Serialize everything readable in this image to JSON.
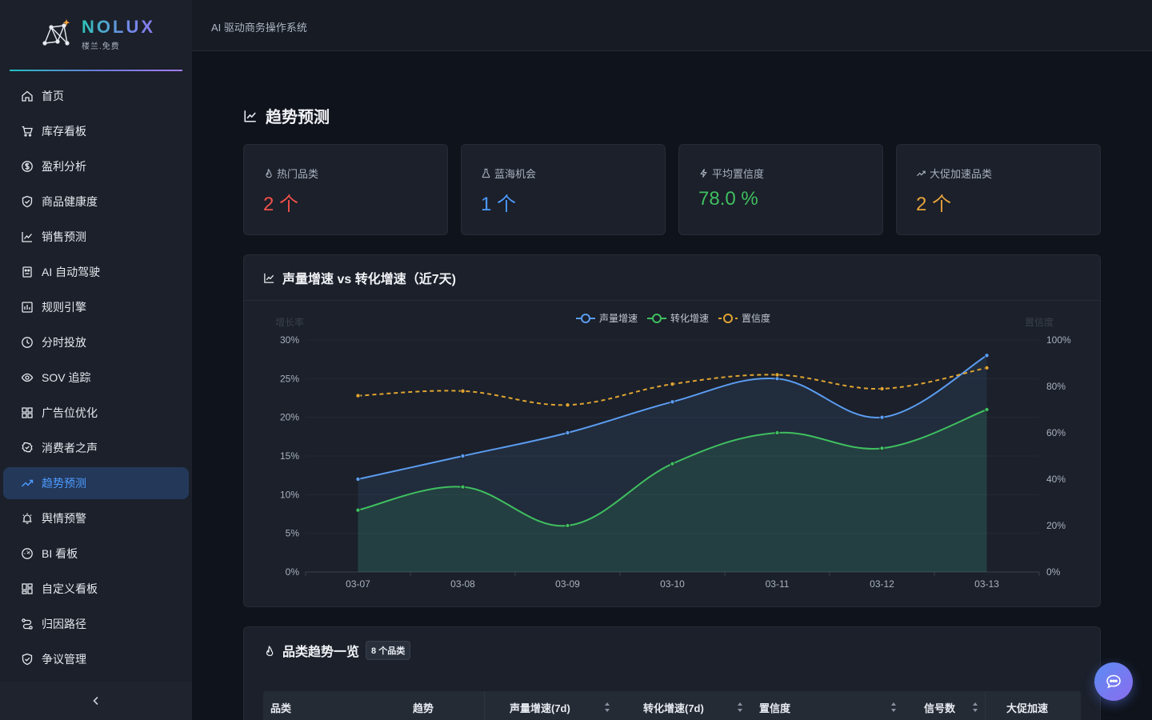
{
  "brand": {
    "name": "NOLUX",
    "subtitle": "楼兰.免费"
  },
  "topbar": {
    "title": "AI 驱动商务操作系统"
  },
  "sidebar": {
    "items": [
      {
        "label": "首页",
        "icon": "home-icon"
      },
      {
        "label": "库存看板",
        "icon": "cart-icon"
      },
      {
        "label": "盈利分析",
        "icon": "coin-icon"
      },
      {
        "label": "商品健康度",
        "icon": "shield-check-icon"
      },
      {
        "label": "销售预测",
        "icon": "line-chart-icon"
      },
      {
        "label": "AI 自动驾驶",
        "icon": "robot-icon"
      },
      {
        "label": "规则引擎",
        "icon": "rules-icon"
      },
      {
        "label": "分时投放",
        "icon": "clock-icon"
      },
      {
        "label": "SOV 追踪",
        "icon": "eye-icon"
      },
      {
        "label": "广告位优化",
        "icon": "grid-icon"
      },
      {
        "label": "消费者之声",
        "icon": "badge-icon"
      },
      {
        "label": "趋势预测",
        "icon": "trend-icon",
        "active": true
      },
      {
        "label": "舆情预警",
        "icon": "alarm-icon"
      },
      {
        "label": "BI 看板",
        "icon": "dashboard-icon"
      },
      {
        "label": "自定义看板",
        "icon": "layout-icon"
      },
      {
        "label": "归因路径",
        "icon": "route-icon"
      },
      {
        "label": "争议管理",
        "icon": "shield-check-icon"
      }
    ],
    "collapse_label": "‹"
  },
  "page": {
    "title": "趋势预测"
  },
  "stats": [
    {
      "label": "热门品类",
      "value": "2 个",
      "color": "#f0504a",
      "icon": "fire-icon"
    },
    {
      "label": "蓝海机会",
      "value": "1 个",
      "color": "#4d9bff",
      "icon": "flask-icon"
    },
    {
      "label": "平均置信度",
      "value": "78.0 %",
      "color": "#3fbf5f",
      "icon": "lightning-icon"
    },
    {
      "label": "大促加速品类",
      "value": "2 个",
      "color": "#e8a33c",
      "icon": "rise-icon"
    }
  ],
  "chart_card": {
    "title": "声量增速 vs 转化增速（近7天)"
  },
  "chart_data": {
    "type": "line",
    "categories": [
      "03-07",
      "03-08",
      "03-09",
      "03-10",
      "03-11",
      "03-12",
      "03-13"
    ],
    "series": [
      {
        "name": "声量增速",
        "values": [
          12,
          15,
          18,
          22,
          25,
          20,
          28
        ],
        "axis": "left",
        "color": "#5b9cf0",
        "area": true,
        "dashed": false
      },
      {
        "name": "转化增速",
        "values": [
          8,
          11,
          6,
          14,
          18,
          16,
          21
        ],
        "axis": "left",
        "color": "#3fbf5f",
        "area": true,
        "dashed": false
      },
      {
        "name": "置信度",
        "values": [
          76,
          78,
          72,
          81,
          85,
          79,
          88
        ],
        "axis": "right",
        "color": "#e0a431",
        "area": false,
        "dashed": true
      }
    ],
    "ylabel": "增长率",
    "ylabel_right": "置信度",
    "ylim": [
      0,
      30
    ],
    "ylim_right": [
      0,
      100
    ],
    "yticks": [
      "0%",
      "5%",
      "10%",
      "15%",
      "20%",
      "25%",
      "30%"
    ],
    "yticks_right": [
      "0%",
      "20%",
      "40%",
      "60%",
      "80%",
      "100%"
    ],
    "legend_position": "top-center",
    "grid": true
  },
  "table_card": {
    "title": "品类趋势一览",
    "badge": "8 个品类",
    "columns": [
      {
        "label": "品类",
        "sortable": false
      },
      {
        "label": "趋势",
        "sortable": false
      },
      {
        "label": "声量增速(7d)",
        "sortable": true
      },
      {
        "label": "转化增速(7d)",
        "sortable": true
      },
      {
        "label": "置信度",
        "sortable": true
      },
      {
        "label": "信号数",
        "sortable": true
      },
      {
        "label": "大促加速",
        "sortable": false
      }
    ]
  }
}
